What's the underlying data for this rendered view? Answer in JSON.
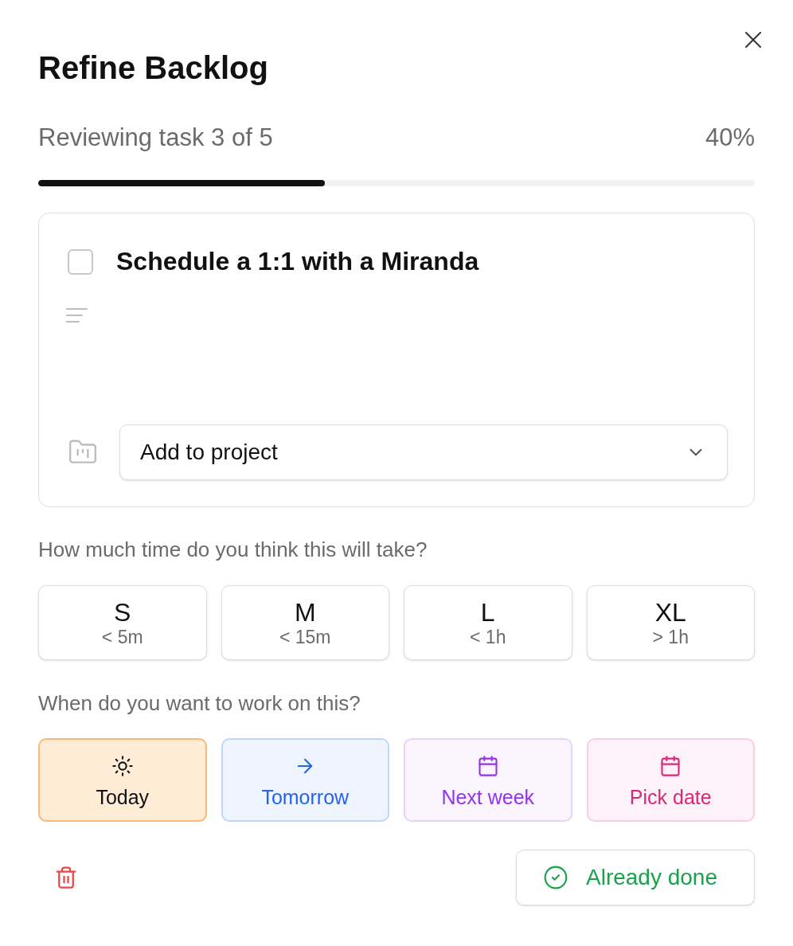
{
  "dialog": {
    "title": "Refine Backlog"
  },
  "progress": {
    "label": "Reviewing task 3 of 5",
    "percent": "40%",
    "level": 0.4
  },
  "task": {
    "title": "Schedule a 1:1 with a Miranda",
    "checked": false,
    "project_select": {
      "label": "Add to project"
    }
  },
  "time_estimate": {
    "question": "How much time do you think this will take?",
    "options": [
      {
        "size": "S",
        "limit": "< 5m"
      },
      {
        "size": "M",
        "limit": "< 15m"
      },
      {
        "size": "L",
        "limit": "< 1h"
      },
      {
        "size": "XL",
        "limit": "> 1h"
      }
    ]
  },
  "schedule": {
    "question": "When do you want to work on this?",
    "options": [
      {
        "kind": "today",
        "label": "Today"
      },
      {
        "kind": "tomorrow",
        "label": "Tomorrow"
      },
      {
        "kind": "next_week",
        "label": "Next week"
      },
      {
        "kind": "pick_date",
        "label": "Pick date"
      }
    ]
  },
  "actions": {
    "done": "Already done"
  }
}
